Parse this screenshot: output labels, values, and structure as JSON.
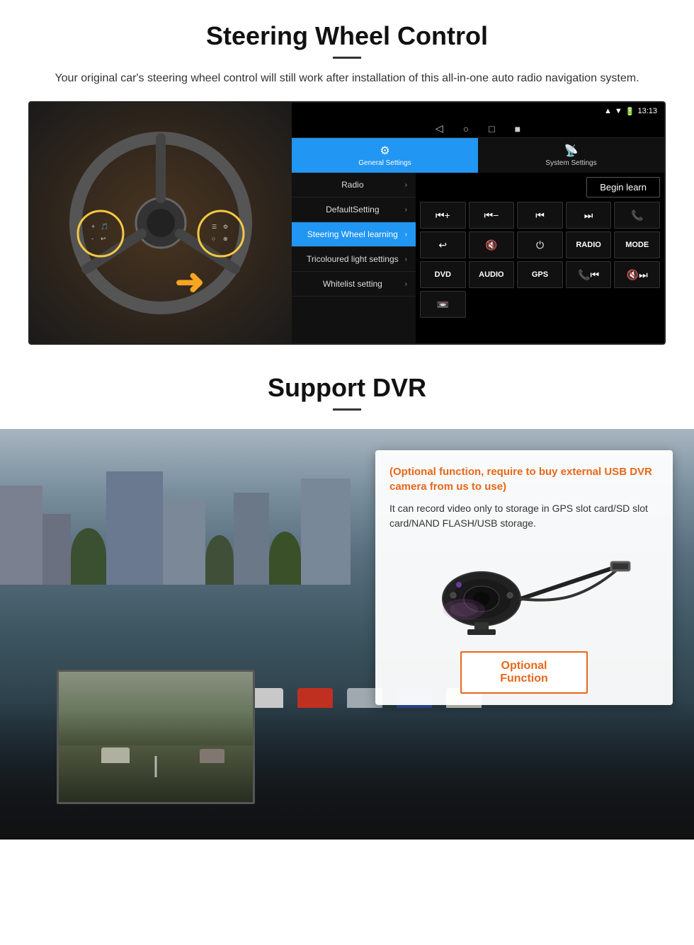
{
  "steering_section": {
    "title": "Steering Wheel Control",
    "description": "Your original car's steering wheel control will still work after installation of this all-in-one auto radio navigation system.",
    "android_ui": {
      "status_bar": {
        "time": "13:13",
        "icons": [
          "signal",
          "wifi",
          "battery"
        ]
      },
      "nav_buttons": [
        "◁",
        "○",
        "□",
        "■"
      ],
      "tabs": [
        {
          "icon": "⚙",
          "label": "General Settings",
          "active": true
        },
        {
          "icon": "📡",
          "label": "System Settings",
          "active": false
        }
      ],
      "menu_items": [
        {
          "label": "Radio",
          "active": false
        },
        {
          "label": "DefaultSetting",
          "active": false
        },
        {
          "label": "Steering Wheel learning",
          "active": true
        },
        {
          "label": "Tricoloured light settings",
          "active": false
        },
        {
          "label": "Whitelist setting",
          "active": false
        }
      ],
      "begin_learn": "Begin learn",
      "control_buttons": [
        "⏮+",
        "⏮-",
        "⏮⏮",
        "⏭⏭",
        "📞",
        "↩",
        "🔇",
        "⏻",
        "RADIO",
        "MODE",
        "DVD",
        "AUDIO",
        "GPS",
        "📞⏮",
        "🔇⏭",
        "📼"
      ]
    }
  },
  "dvr_section": {
    "title": "Support DVR",
    "optional_text": "(Optional function, require to buy external USB DVR camera from us to use)",
    "description": "It can record video only to storage in GPS slot card/SD slot card/NAND FLASH/USB storage.",
    "optional_button": "Optional Function"
  }
}
